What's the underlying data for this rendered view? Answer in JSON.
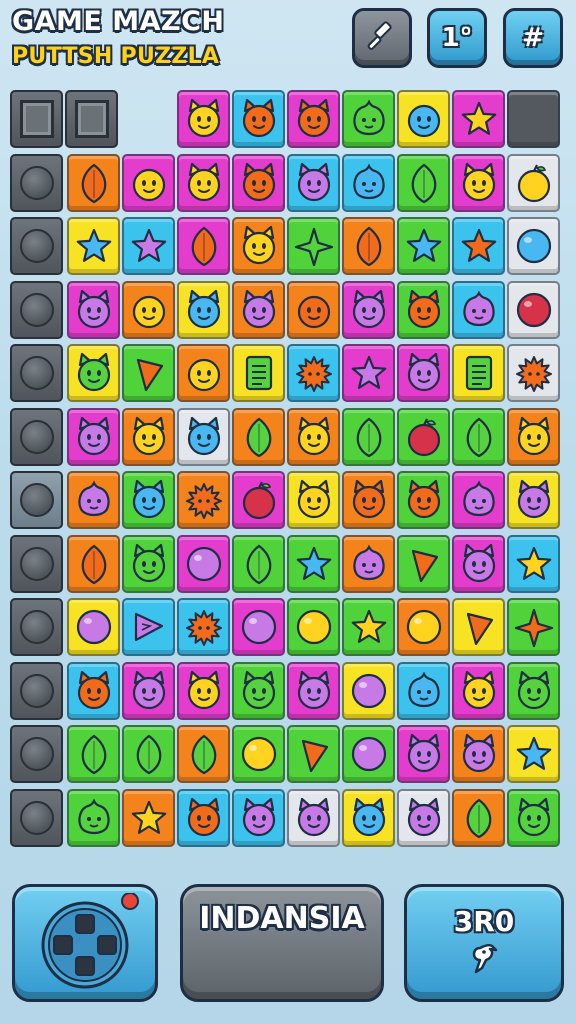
{
  "header": {
    "title": "GAME MAZCH",
    "subtitle": "PUTTSH PUZZLA",
    "buttons": [
      {
        "icon": "wrench-icon",
        "label": ""
      },
      {
        "icon": "",
        "label": "1°"
      },
      {
        "icon": "",
        "label": "#"
      }
    ]
  },
  "board": {
    "cols": 9,
    "rows": 12,
    "side_column": [
      "square",
      "knob",
      "knob",
      "knob",
      "knob",
      "knob",
      "knob-light",
      "knob",
      "knob",
      "knob",
      "knob",
      "knob"
    ],
    "grid": [
      [
        "magenta:cat-y",
        "cyan:cat-o",
        "magenta:cat-o",
        "green:drop-g",
        "yellow:face-b",
        "magenta:star-y",
        "dark:empty"
      ],
      [
        "orange:leaf-o",
        "magenta:face-y",
        "magenta:cat-y",
        "magenta:cat-o",
        "cyan:cat-p",
        "cyan:drop-b",
        "green:leaf-g",
        "magenta:cat-y",
        "white:fruit-y"
      ],
      [
        "yellow:star-b",
        "cyan:star-p",
        "magenta:leaf-o",
        "orange:cat-y",
        "green:star4-g",
        "orange:leaf-o",
        "green:star-b",
        "cyan:star-o",
        "white:ball-b"
      ],
      [
        "magenta:cat-p",
        "orange:face-y",
        "yellow:cat-b",
        "orange:cat-p",
        "orange:face-o",
        "magenta:cat-p",
        "green:cat-o",
        "cyan:drop-p",
        "white:ball-r"
      ],
      [
        "yellow:cat-g",
        "green:carrot-o",
        "orange:face-y",
        "yellow:doc-g",
        "cyan:spiky-o",
        "magenta:star-p",
        "magenta:cat-p",
        "yellow:doc-g",
        "white:spiky-o"
      ],
      [
        "magenta:cat-p",
        "orange:cat-y",
        "white:cat-b",
        "orange:leaf-g",
        "orange:cat-y",
        "green:leaf-g",
        "green:fruit-r",
        "green:leaf-g",
        "orange:cat-y"
      ],
      [
        "orange:drop-p",
        "green:cat-b",
        "orange:spiky-o",
        "magenta:fruit-r",
        "yellow:cat-y",
        "orange:cat-o",
        "green:cat-o",
        "magenta:drop-p",
        "yellow:cat-p"
      ],
      [
        "orange:leaf-o",
        "green:cat-g",
        "magenta:ball-p",
        "green:leaf-g",
        "green:star-b",
        "orange:drop-p",
        "green:carrot-o",
        "magenta:cat-p",
        "cyan:star-y"
      ],
      [
        "yellow:ball-p",
        "cyan:flag-p",
        "cyan:spiky-o",
        "magenta:ball-p",
        "green:ball-y",
        "green:star-y",
        "orange:ball-y",
        "yellow:carrot-o",
        "green:star4-o"
      ],
      [
        "cyan:cat-o",
        "magenta:cat-p",
        "magenta:cat-y",
        "green:cat-g",
        "magenta:cat-p",
        "yellow:ball-p",
        "cyan:drop-b",
        "magenta:cat-y",
        "green:cat-g"
      ],
      [
        "green:leaf-g",
        "green:leaf-g",
        "orange:leaf-g",
        "green:ball-y",
        "green:carrot-o",
        "green:ball-p",
        "magenta:cat-p",
        "orange:cat-p",
        "yellow:star-b"
      ],
      [
        "green:drop-g",
        "orange:star-y",
        "cyan:cat-o",
        "cyan:cat-p",
        "white:cat-p",
        "yellow:cat-b",
        "white:cat-p",
        "orange:leaf-g",
        "green:cat-g"
      ]
    ],
    "first_row_start": 3
  },
  "footer": {
    "left": {
      "icon": "dpad-icon"
    },
    "middle": {
      "label": "INDANSIA"
    },
    "right": {
      "label": "3R0",
      "icon": "duck-icon"
    }
  },
  "colors": {
    "magenta": "#e43ccc",
    "cyan": "#3bc3ee",
    "green": "#4fd23a",
    "yellow": "#f7e324",
    "orange": "#f5831b",
    "white": "#e3e6ea",
    "dark": "#54595f",
    "outline": "#1e2e44"
  }
}
